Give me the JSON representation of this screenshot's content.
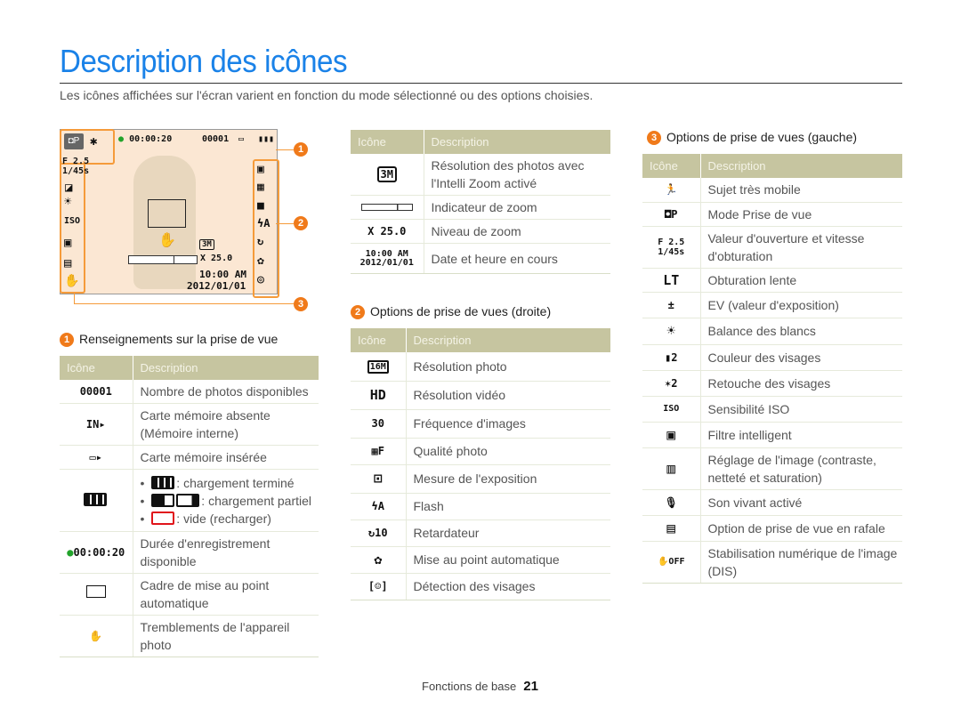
{
  "page": {
    "title": "Description des icônes",
    "intro": "Les icônes affichées sur l'écran varient en fonction du mode sélectionné ou des options choisies.",
    "footer_label": "Fonctions de base",
    "page_number": "21"
  },
  "screen": {
    "rec_time": "00:00:20",
    "shot_count": "00001",
    "aperture": "F 2.5",
    "shutter": "1/45s",
    "zoom_level": "X 25.0",
    "time": "10:00 AM",
    "date": "2012/01/01",
    "callouts": [
      "1",
      "2",
      "3"
    ],
    "accent": "#f07a1a"
  },
  "table_header": {
    "icon": "Icône",
    "description": "Description"
  },
  "section1": {
    "number": "1",
    "title": "Renseignements sur la prise de vue",
    "rows": [
      {
        "icon": "00001",
        "icon_name": "shot-count-icon",
        "desc": "Nombre de photos disponibles"
      },
      {
        "icon": "IN▸",
        "icon_name": "internal-memory-icon",
        "desc": "Carte mémoire absente (Mémoire interne)"
      },
      {
        "icon": "▭▸",
        "icon_name": "memory-card-icon",
        "desc": "Carte mémoire insérée"
      },
      {
        "icon": "battery",
        "icon_name": "battery-icon",
        "bullets": [
          ": chargement terminé",
          ": chargement partiel",
          ": vide (recharger)"
        ]
      },
      {
        "icon": "● 00:00:20",
        "icon_name": "recording-time-icon",
        "desc": "Durée d'enregistrement disponible"
      },
      {
        "icon": "▭",
        "icon_name": "af-frame-icon",
        "desc": "Cadre de mise au point automatique"
      },
      {
        "icon": "✋",
        "icon_name": "camera-shake-icon",
        "desc": "Tremblements de l'appareil photo"
      }
    ]
  },
  "section_mid": {
    "rows": [
      {
        "icon": "3M",
        "icon_name": "intelli-zoom-resolution-icon",
        "desc": "Résolution des photos avec l'Intelli Zoom activé"
      },
      {
        "icon": "zoombar",
        "icon_name": "zoom-indicator-icon",
        "desc": "Indicateur de zoom"
      },
      {
        "icon": "X 25.0",
        "icon_name": "zoom-level-icon",
        "desc": "Niveau de zoom"
      },
      {
        "icon": "10:00 AM 2012/01/01",
        "icon_name": "date-time-icon",
        "desc": "Date et heure en cours"
      }
    ]
  },
  "section2": {
    "number": "2",
    "title": "Options de prise de vues (droite)",
    "rows": [
      {
        "icon": "16M",
        "icon_name": "photo-resolution-icon",
        "desc": "Résolution photo"
      },
      {
        "icon": "HD",
        "icon_name": "video-resolution-icon",
        "desc": "Résolution vidéo"
      },
      {
        "icon": "30",
        "icon_name": "frame-rate-icon",
        "desc": "Fréquence d'images"
      },
      {
        "icon": "▦F",
        "icon_name": "photo-quality-icon",
        "desc": "Qualité photo"
      },
      {
        "icon": "⊡",
        "icon_name": "metering-icon",
        "desc": "Mesure de l'exposition"
      },
      {
        "icon": "ϟA",
        "icon_name": "flash-icon",
        "desc": "Flash"
      },
      {
        "icon": "↻10",
        "icon_name": "timer-icon",
        "desc": "Retardateur"
      },
      {
        "icon": "✿",
        "icon_name": "macro-af-icon",
        "desc": "Mise au point automatique"
      },
      {
        "icon": "[☺]",
        "icon_name": "face-detection-icon",
        "desc": "Détection des visages"
      }
    ]
  },
  "section3": {
    "number": "3",
    "title": "Options de prise de vues (gauche)",
    "rows": [
      {
        "icon": "🏃",
        "icon_name": "fast-subject-icon",
        "desc": "Sujet très mobile"
      },
      {
        "icon": "◘P",
        "icon_name": "shooting-mode-icon",
        "desc": "Mode Prise de vue"
      },
      {
        "icon": "F 2.5 1/45s",
        "icon_name": "aperture-shutter-icon",
        "desc": "Valeur d'ouverture et vitesse d'obturation"
      },
      {
        "icon": "LT",
        "icon_name": "long-shutter-icon",
        "desc": "Obturation lente"
      },
      {
        "icon": "±",
        "icon_name": "ev-icon",
        "desc": "EV (valeur d'exposition)"
      },
      {
        "icon": "☀",
        "icon_name": "white-balance-icon",
        "desc": "Balance des blancs"
      },
      {
        "icon": "▮2",
        "icon_name": "face-tone-icon",
        "desc": "Couleur des visages"
      },
      {
        "icon": "✶2",
        "icon_name": "face-retouch-icon",
        "desc": "Retouche des visages"
      },
      {
        "icon": "ISO",
        "icon_name": "iso-icon",
        "desc": "Sensibilité ISO"
      },
      {
        "icon": "▣",
        "icon_name": "smart-filter-icon",
        "desc": "Filtre intelligent"
      },
      {
        "icon": "▥",
        "icon_name": "image-adjust-icon",
        "desc": "Réglage de l'image (contraste, netteté et saturation)"
      },
      {
        "icon": "🎙",
        "icon_name": "live-sound-icon",
        "desc": "Son vivant activé"
      },
      {
        "icon": "▤",
        "icon_name": "burst-icon",
        "desc": "Option de prise de vue en rafale"
      },
      {
        "icon": "✋OFF",
        "icon_name": "dis-off-icon",
        "desc": "Stabilisation numérique de l'image (DIS)"
      }
    ]
  }
}
